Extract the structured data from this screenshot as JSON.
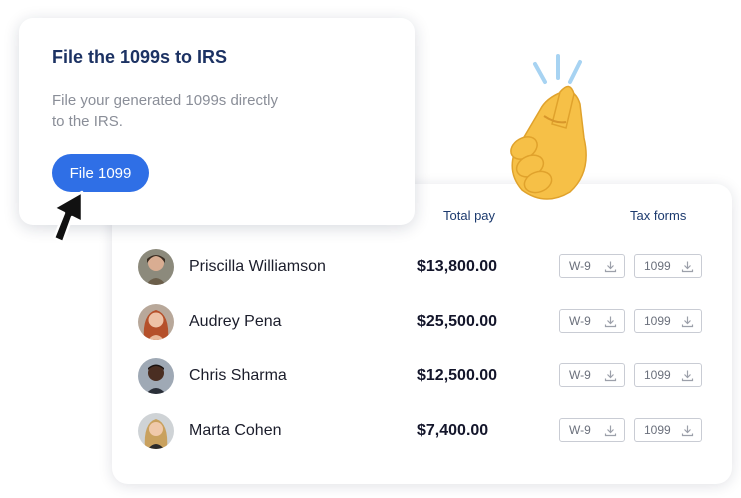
{
  "file_card": {
    "title": "File the 1099s to IRS",
    "description": "File your generated 1099s directly to the IRS.",
    "button_label": "File 1099"
  },
  "table": {
    "columns": {
      "total_pay": "Total pay",
      "tax_forms": "Tax forms"
    },
    "rows": [
      {
        "name": "Priscilla Williamson",
        "pay": "$13,800.00",
        "form1": "W-9",
        "form2": "1099"
      },
      {
        "name": "Audrey Pena",
        "pay": "$25,500.00",
        "form1": "W-9",
        "form2": "1099"
      },
      {
        "name": "Chris Sharma",
        "pay": "$12,500.00",
        "form1": "W-9",
        "form2": "1099"
      },
      {
        "name": "Marta Cohen",
        "pay": "$7,400.00",
        "form1": "W-9",
        "form2": "1099"
      }
    ]
  },
  "icons": {
    "cursor": "cursor-arrow-icon",
    "hand": "finger-snap-hand-icon",
    "download": "download-icon"
  },
  "colors": {
    "accent": "#2f6fe6",
    "title": "#1c3263",
    "hand": "#f6c047",
    "snap_lines": "#a7d3f2"
  }
}
